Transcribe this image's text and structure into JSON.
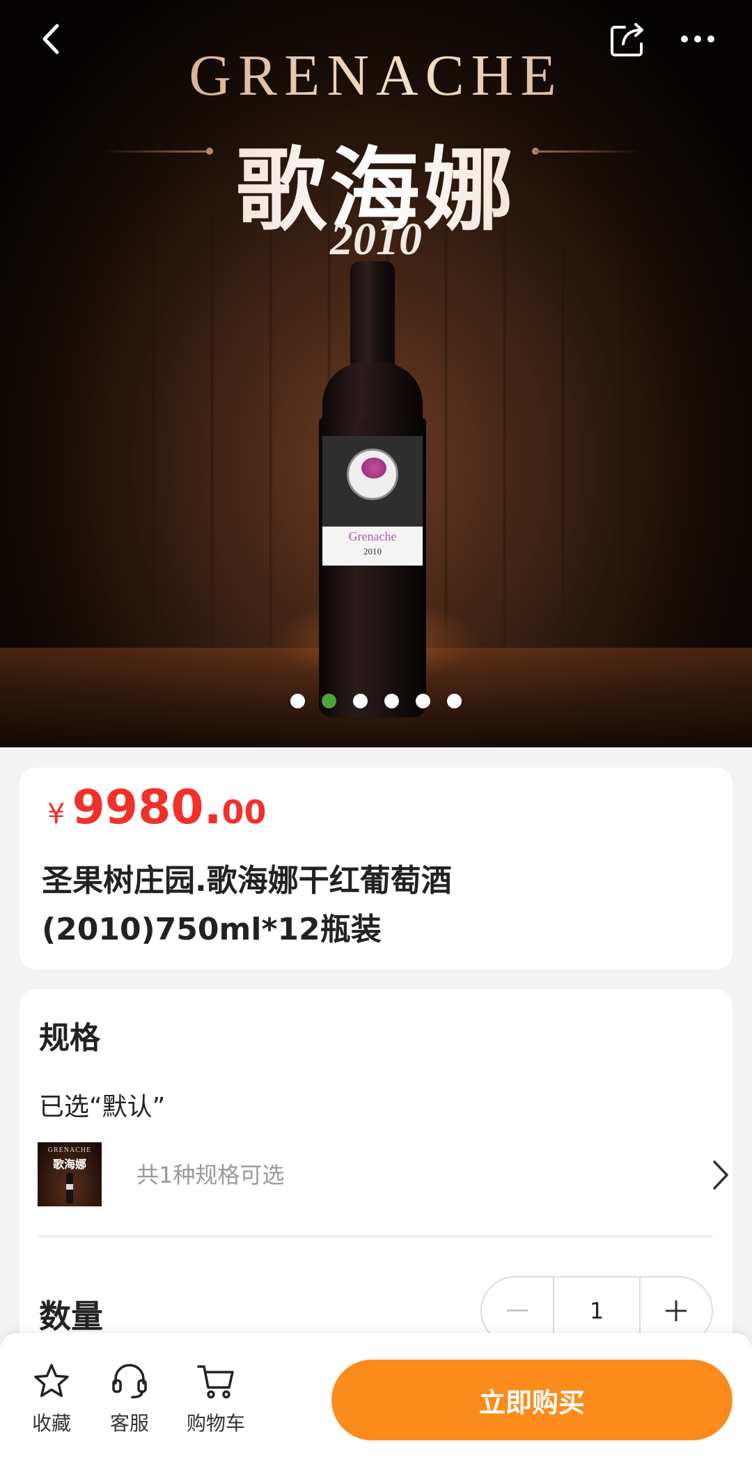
{
  "hero": {
    "title_en": "GRENACHE",
    "title_cn": "歌海娜",
    "year": "2010",
    "bottle_label_name": "Grenache",
    "bottle_label_year": "2010",
    "slide_count": 6,
    "active_slide": 2
  },
  "thumbnail": {
    "title_en": "GRENACHE",
    "title_cn": "歌海娜"
  },
  "product": {
    "currency_symbol": "¥",
    "price_integer": "9980.",
    "price_decimal": "00",
    "title": "圣果树庄园.歌海娜干红葡萄酒(2010)750ml*12瓶装"
  },
  "spec": {
    "section_title": "规格",
    "selected_text": "已选“默认”",
    "available_text": "共1种规格可选",
    "quantity_label": "数量",
    "quantity_value": "1"
  },
  "bottom_bar": {
    "favorite_label": "收藏",
    "service_label": "客服",
    "cart_label": "购物车",
    "buy_now_label": "立即购买"
  },
  "icons": {
    "back": "chevron-left-icon",
    "share": "share-icon",
    "more": "more-dots-icon",
    "spec_arrow": "chevron-right-icon",
    "minus": "minus-icon",
    "plus": "plus-icon",
    "favorite": "star-icon",
    "service": "headset-icon",
    "cart": "cart-icon"
  },
  "colors": {
    "price": "#f1302a",
    "buy_button": "#fb8c1c",
    "active_dot": "#4fa53b",
    "page_background": "#f3f3f3"
  }
}
